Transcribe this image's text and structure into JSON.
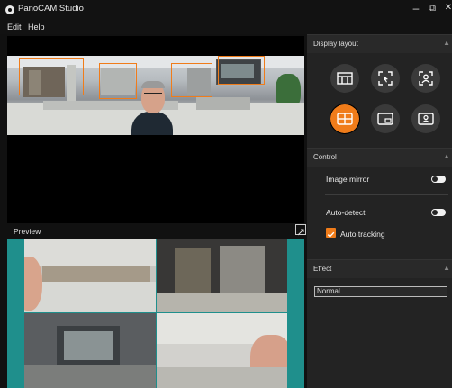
{
  "app": {
    "title": "PanoCAM Studio",
    "logo_icon": "app-logo-icon"
  },
  "window_controls": {
    "minimize": "–",
    "restore": "⧉",
    "close": "✕"
  },
  "menu": {
    "items": [
      "Edit",
      "Help"
    ]
  },
  "main_view": {
    "detect_box_count": 4,
    "accent": "#f07c1a"
  },
  "preview": {
    "label": "Preview",
    "expand_icon": "expand-icon",
    "tile_count": 4
  },
  "panel": {
    "display_layout": {
      "title": "Display layout",
      "buttons": [
        {
          "name": "layout-table-button",
          "icon": "table-layout-icon",
          "active": false
        },
        {
          "name": "layout-speaker-focus-button",
          "icon": "cursor-frame-icon",
          "active": false
        },
        {
          "name": "layout-person-focus-button",
          "icon": "person-frame-icon",
          "active": false
        },
        {
          "name": "layout-grid-button",
          "icon": "grid-icon",
          "active": true
        },
        {
          "name": "layout-pip-button",
          "icon": "picture-in-picture-icon",
          "active": false
        },
        {
          "name": "layout-presenter-button",
          "icon": "presenter-icon",
          "active": false
        }
      ]
    },
    "control": {
      "title": "Control",
      "image_mirror_label": "Image mirror",
      "image_mirror_on": false,
      "auto_detect_label": "Auto-detect",
      "auto_detect_on": false,
      "auto_tracking_label": "Auto tracking",
      "auto_tracking_checked": true
    },
    "effect": {
      "title": "Effect",
      "selected": "Normal"
    }
  },
  "colors": {
    "accent": "#f07c1a",
    "background": "#111111",
    "panel": "#232323",
    "preview_bg": "#1f8f8c"
  }
}
